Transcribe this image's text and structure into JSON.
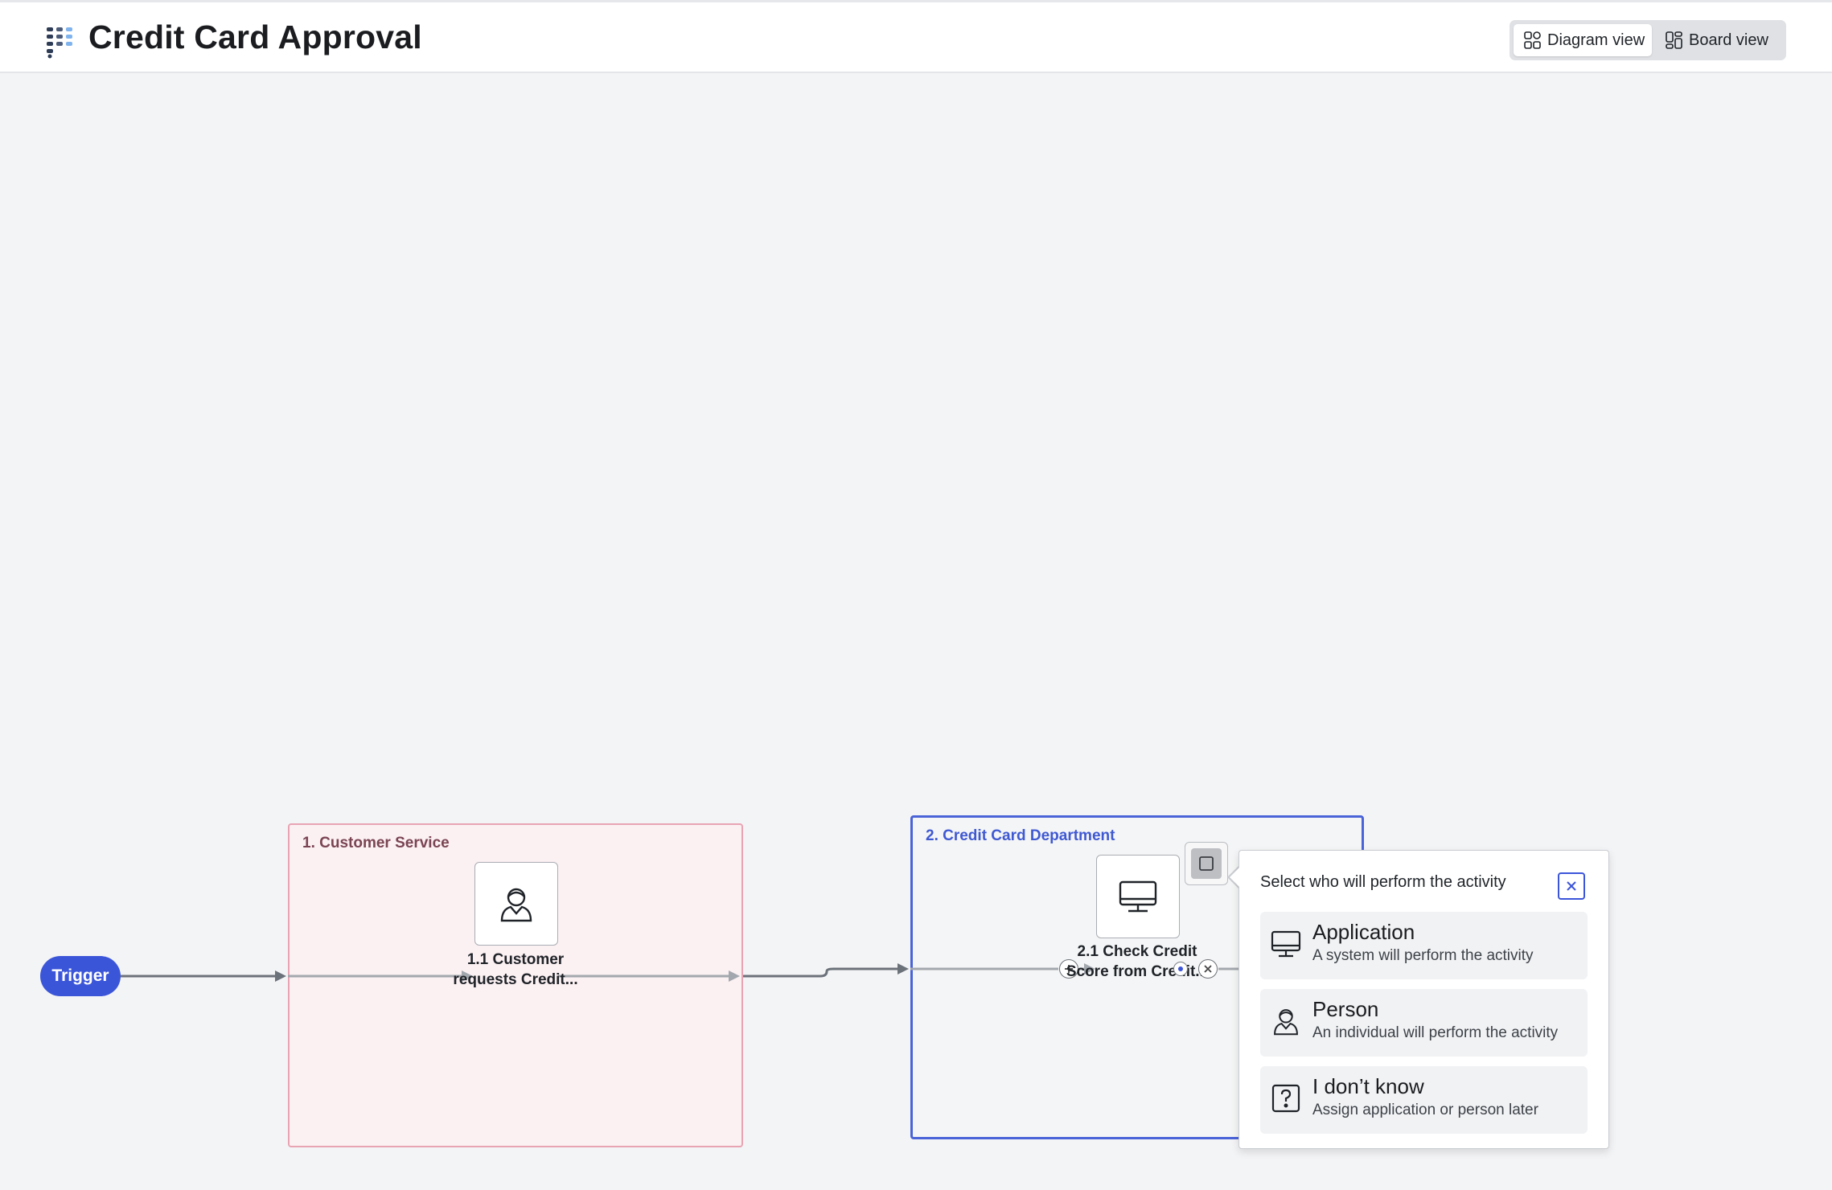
{
  "header": {
    "title": "Credit Card Approval",
    "views": [
      {
        "label": "Diagram view",
        "active": true,
        "icon": "diagram-icon"
      },
      {
        "label": "Board view",
        "active": false,
        "icon": "board-icon"
      }
    ]
  },
  "diagram": {
    "trigger": {
      "label": "Trigger"
    },
    "lanes": [
      {
        "label": "1. Customer Service",
        "color": "#e8a4b3"
      },
      {
        "label": "2. Credit Card Department",
        "color": "#4a63d8"
      }
    ],
    "activities": [
      {
        "label_line1": "1.1 Customer",
        "label_line2": "requests Credit...",
        "icon": "person-icon"
      },
      {
        "label_line1": "2.1 Check Credit",
        "label_line2": "Score from Credit...",
        "icon": "monitor-icon"
      }
    ]
  },
  "popup": {
    "title": "Select who will perform the activity",
    "options": [
      {
        "title": "Application",
        "description": "A system will perform the activity",
        "icon": "monitor-icon"
      },
      {
        "title": "Person",
        "description": "An individual will perform the activity",
        "icon": "person-icon"
      },
      {
        "title": "I don’t know",
        "description": "Assign application or person later",
        "icon": "question-icon"
      }
    ]
  },
  "colors": {
    "accent": "#3b55d9",
    "lane_pink": "#e8a4b3",
    "lane_blue": "#4a63d8"
  }
}
